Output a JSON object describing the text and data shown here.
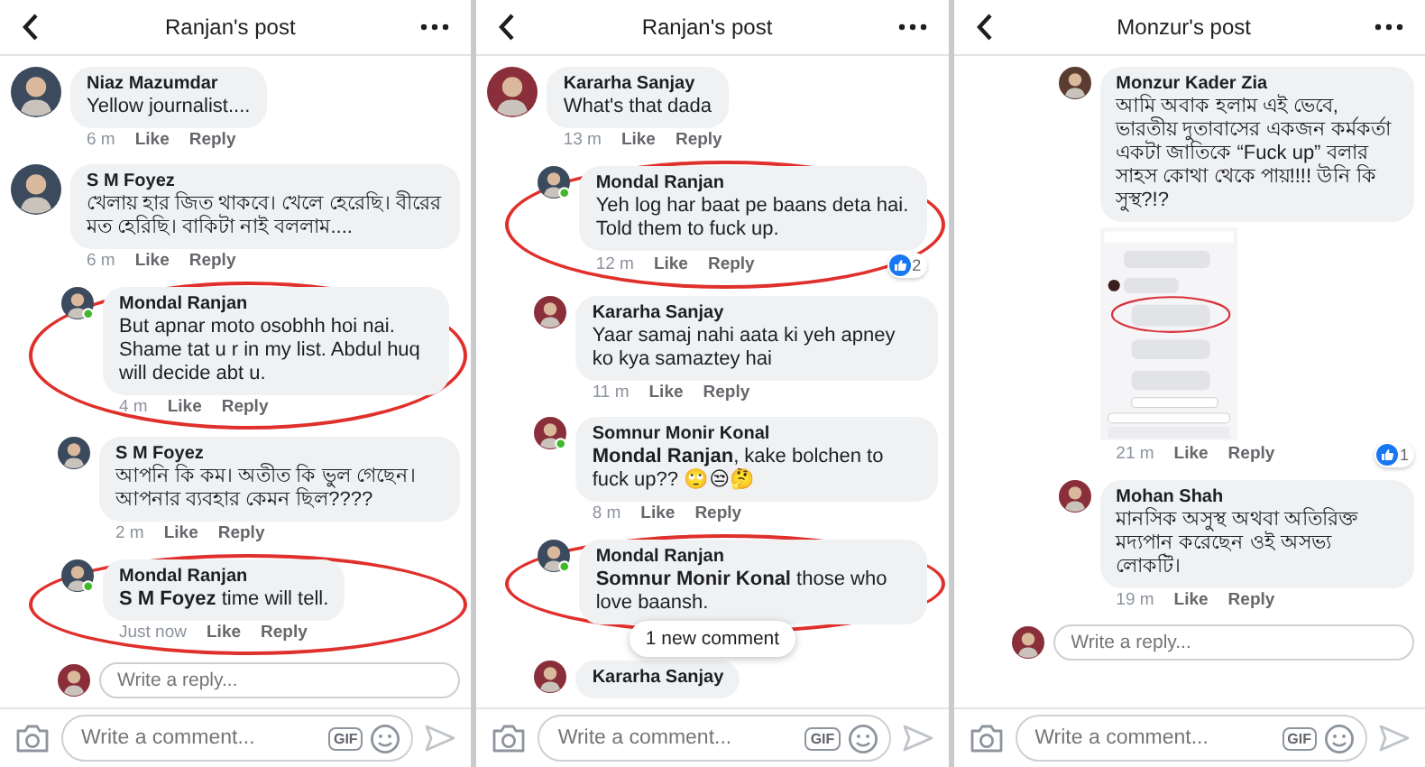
{
  "panels": [
    {
      "title": "Ranjan's post",
      "comments": [
        {
          "name": "Niaz Mazumdar",
          "text": "Yellow journalist....",
          "time": "6 m",
          "like": "Like",
          "reply": "Reply",
          "online": false,
          "circled": false
        },
        {
          "name": "S M Foyez",
          "text": "খেলায় হার জিত থাকবে। খেলে হেরেছি। বীরের মত হেরিছি। বাকিটা নাই বললাম....",
          "time": "6 m",
          "like": "Like",
          "reply": "Reply",
          "online": false,
          "circled": false,
          "children": [
            {
              "name": "Mondal Ranjan",
              "text": "But apnar moto osobhh hoi nai. Shame tat u r in my list. Abdul huq will decide abt u.",
              "time": "4 m",
              "like": "Like",
              "reply": "Reply",
              "online": true,
              "circled": true
            },
            {
              "name": "S M Foyez",
              "text": "আপনি কি কম। অতীত কি ভুল গেছেন। আপনার ব্যবহার কেমন ছিল????",
              "time": "2 m",
              "like": "Like",
              "reply": "Reply",
              "online": false,
              "circled": false
            },
            {
              "name": "Mondal Ranjan",
              "text": "**S M Foyez** time will tell.",
              "time": "Just now",
              "like": "Like",
              "reply": "Reply",
              "online": true,
              "circled": true
            }
          ]
        }
      ],
      "reply_field": {
        "placeholder": "Write a reply..."
      },
      "composer": {
        "placeholder": "Write a comment...",
        "gif": "GIF"
      }
    },
    {
      "title": "Ranjan's post",
      "comments": [
        {
          "name": "Kararha Sanjay",
          "text": "What's that dada",
          "time": "13 m",
          "like": "Like",
          "reply": "Reply",
          "online": false,
          "circled": false,
          "children": [
            {
              "name": "Mondal Ranjan",
              "text": "Yeh log har baat pe baans deta hai. Told them to fuck up.",
              "time": "12 m",
              "like": "Like",
              "reply": "Reply",
              "online": true,
              "circled": true,
              "reactions": "2"
            },
            {
              "name": "Kararha Sanjay",
              "text": "Yaar samaj nahi aata ki yeh apney ko kya samaztey hai",
              "time": "11 m",
              "like": "Like",
              "reply": "Reply",
              "online": false,
              "circled": false
            },
            {
              "name": "Somnur Monir Konal",
              "text": "**Mondal Ranjan**, kake bolchen to fuck up?? 🙄😒🤔",
              "time": "8 m",
              "like": "Like",
              "reply": "Reply",
              "online": true,
              "circled": false
            },
            {
              "name": "Mondal Ranjan",
              "text": "**Somnur Monir Konal** those who love baansh.",
              "online": true,
              "circled": true
            },
            {
              "name": "Kararha Sanjay",
              "online": false,
              "circled": false
            }
          ]
        }
      ],
      "new_comments": "1 new comment",
      "composer": {
        "placeholder": "Write a comment...",
        "gif": "GIF"
      }
    },
    {
      "title": "Monzur's post",
      "replies": [
        {
          "name": "Monzur Kader Zia",
          "text": "আমি অবাক হলাম এই ভেবে,  ভারতীয় দুতাবাসের একজন কর্মকর্তা একটা জাতিকে “Fuck up” বলার সাহস কোথা থেকে পায়!!!! উনি কি সুস্থ?!?",
          "time": "21 m",
          "like": "Like",
          "reply": "Reply",
          "online": false,
          "circled": false,
          "reactions": "1"
        },
        {
          "name": "Mohan Shah",
          "text": "মানসিক অসুস্থ অথবা অতিরিক্ত মদ্যপান করেছেন ওই অসভ্য লোকটি।",
          "time": "19 m",
          "like": "Like",
          "reply": "Reply",
          "online": false,
          "circled": false
        }
      ],
      "reply_field": {
        "placeholder": "Write a reply..."
      },
      "composer": {
        "placeholder": "Write a comment...",
        "gif": "GIF"
      }
    }
  ]
}
